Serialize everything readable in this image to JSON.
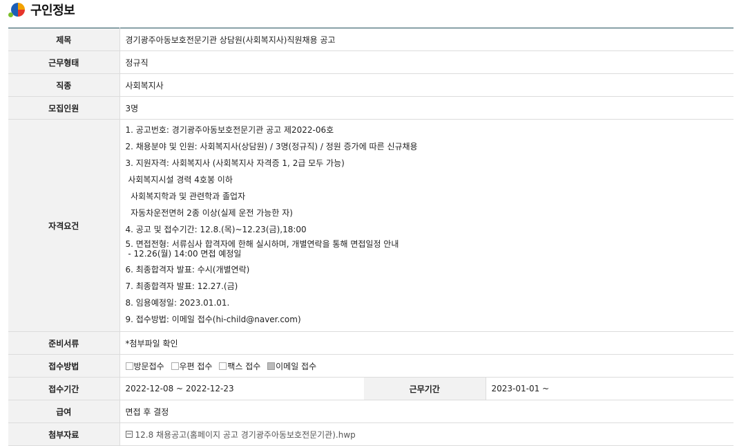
{
  "header": {
    "title": "구인정보"
  },
  "rows": {
    "title": {
      "label": "제목",
      "value": "경기광주아동보호전문기관 상담원(사회복지사)직원채용 공고"
    },
    "work_type": {
      "label": "근무형태",
      "value": "정규직"
    },
    "job": {
      "label": "직종",
      "value": "사회복지사"
    },
    "headcount": {
      "label": "모집인원",
      "value": "3명"
    },
    "requirements": {
      "label": "자격요건",
      "items": [
        "1. 공고번호: 경기광주아동보호전문기관 공고 제2022-06호",
        "2. 채용분야 및 인원: 사회복지사(상담원) / 3명(정규직) / 정원 증가에 따른 신규채용",
        "3. 지원자격: 사회복지사 (사회복지사 자격증 1, 2급 모두 가능)",
        " 사회복지시설 경력 4호봉 이하",
        "  사회복지학과 및 관련학과 졸업자",
        "  자동차운전면허 2종 이상(실제 운전 가능한 자)",
        "4. 공고 및 접수기간: 12.8.(목)~12.23(금),18:00",
        "5. 면접전형: 서류심사 합격자에 한해 실시하며, 개별연락을 통해 면접일정 안내",
        " - 12.26(월) 14:00 면접 예정일",
        "6. 최종합격자 발표: 수시(개별연락)",
        "7. 최종합격자 발표: 12.27.(금)",
        "8. 임용예정일: 2023.01.01.",
        "9. 접수방법: 이메일 접수(hi-child@naver.com)"
      ]
    },
    "documents": {
      "label": "준비서류",
      "value": "*첨부파일 확인"
    },
    "method": {
      "label": "접수방법",
      "options": [
        {
          "text": "방문접수",
          "checked": false
        },
        {
          "text": "우편 접수",
          "checked": false
        },
        {
          "text": "팩스 접수",
          "checked": false
        },
        {
          "text": "이메일 접수",
          "checked": true
        }
      ]
    },
    "period": {
      "label": "접수기간",
      "value": "2022-12-08 ~ 2022-12-23",
      "label2": "근무기간",
      "value2": "2023-01-01 ~"
    },
    "salary": {
      "label": "급여",
      "value": "면접 후 결정"
    },
    "attachment": {
      "label": "첨부자료",
      "value": "12.8 채용공고(홈페이지 공고  경기광주아동보호전문기관).hwp"
    }
  }
}
